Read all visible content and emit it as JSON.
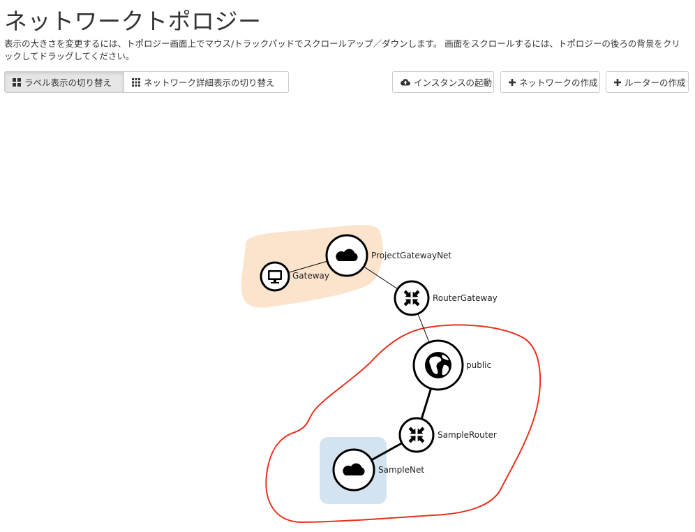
{
  "page": {
    "title": "ネットワークトポロジー",
    "help_text": "表示の大きさを変更するには、トポロジー画面上でマウス/トラックパッドでスクロールアップ／ダウンします。 画面をスクロールするには、トポロジーの後ろの背景をクリックしてドラッグしてください。"
  },
  "toolbar": {
    "toggle_labels": "ラベル表示の切り替え",
    "toggle_network_details": "ネットワーク詳細表示の切り替え",
    "launch_instance": "インスタンスの起動",
    "create_network": "ネットワークの作成",
    "create_router": "ルーターの作成"
  },
  "topology": {
    "nodes": {
      "project_gateway_net": "ProjectGatewayNet",
      "gateway": "Gateway",
      "router_gateway": "RouterGateway",
      "public": "public",
      "sample_router": "SampleRouter",
      "sample_net": "SampleNet"
    },
    "colors": {
      "project_group": "#fbe3cc",
      "sample_group": "#d3e3ef",
      "annotation_outline": "#e8311d",
      "node_border": "#000000"
    }
  }
}
